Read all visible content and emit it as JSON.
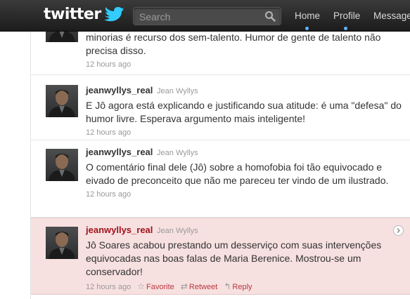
{
  "header": {
    "logo_text": "twitter",
    "search_placeholder": "Search",
    "nav": [
      "Home",
      "Profile",
      "Messages"
    ]
  },
  "tweets": [
    {
      "username": "jeanwyllys_real",
      "realname": "Jean Wyllys",
      "text": "minorias é recurso dos sem-talento. Humor de gente de talento não precisa disso.",
      "time": "12 hours ago"
    },
    {
      "username": "jeanwyllys_real",
      "realname": "Jean Wyllys",
      "text": "E Jô agora está explicando e justificando sua atitude: é uma \"defesa\" do humor livre. Esperava argumento mais inteligente!",
      "time": "12 hours ago"
    },
    {
      "username": "jeanwyllys_real",
      "realname": "Jean Wyllys",
      "text": "O comentário final dele (Jô) sobre a homofobia foi tão equivocado e eivado de preconceito que não me pareceu ter vindo de um ilustrado.",
      "time": "12 hours ago"
    },
    {
      "username": "jeanwyllys_real",
      "realname": "Jean Wyllys",
      "text": "Jô Soares acabou prestando um desserviço com suas intervenções equivocadas nas boas falas de Maria Berenice. Mostrou-se um conservador!",
      "time": "12 hours ago",
      "actions": {
        "favorite": "Favorite",
        "retweet": "Retweet",
        "reply": "Reply"
      }
    }
  ],
  "colors": {
    "topbar": "#1c1c1c",
    "highlight_bg": "#f7e0e0",
    "username_highlight": "#a0121a",
    "action_link": "#b9373f",
    "bird_blue": "#33ccff"
  }
}
